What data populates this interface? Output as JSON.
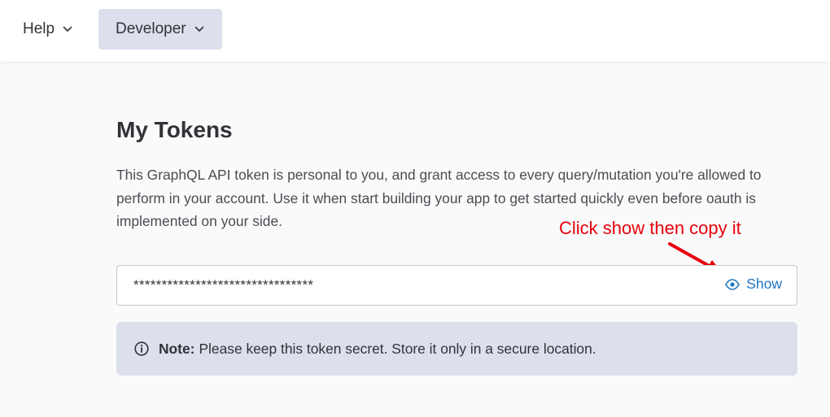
{
  "header": {
    "nav": [
      {
        "label": "Help",
        "icon": "chevron-down-icon"
      },
      {
        "label": "Developer",
        "icon": "chevron-down-icon",
        "active": true
      }
    ]
  },
  "tokens": {
    "title": "My Tokens",
    "description": "This GraphQL API token is personal to you, and grant access to every query/mutation you're allowed to perform in your account. Use it when start building your app to get started quickly even before oauth is implemented on your side.",
    "token_masked": "********************************",
    "show_label": "Show",
    "show_icon": "eye-icon",
    "note_label": "Note:",
    "note_text": "Please keep this token secret. Store it only in a secure location.",
    "note_icon": "info-icon"
  },
  "annotation": {
    "text": "Click show then copy it",
    "color": "#e8000b"
  },
  "colors": {
    "accent": "#1f76c2",
    "nav_active_bg": "#dcdfec",
    "note_bg": "#dcdfec"
  }
}
